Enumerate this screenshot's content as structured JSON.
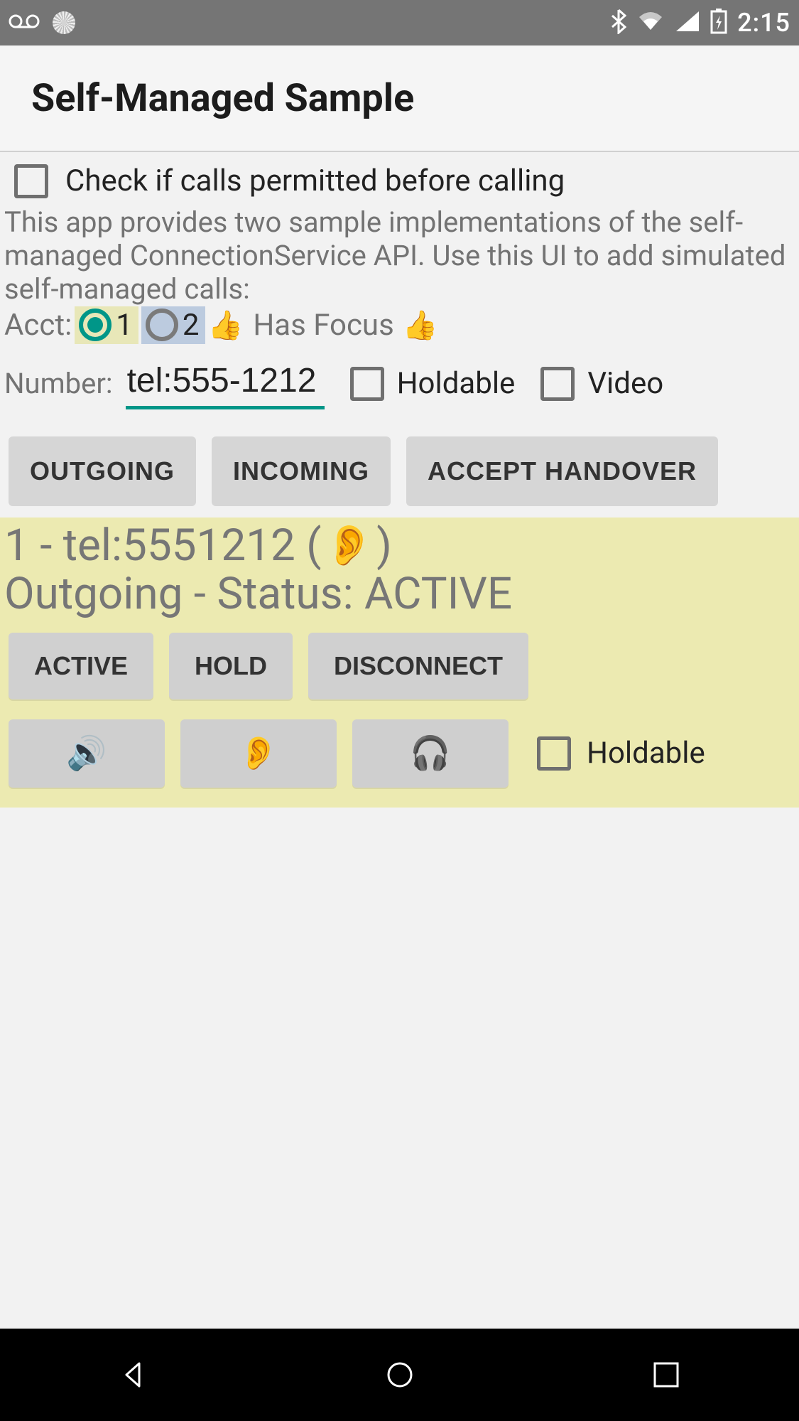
{
  "statusbar": {
    "time": "2:15"
  },
  "actionbar": {
    "title": "Self-Managed Sample"
  },
  "check_permitted": {
    "label": "Check if calls permitted before calling",
    "checked": false
  },
  "description": "This app provides two sample implementations of the self-managed ConnectionService API.  Use this UI to add simulated self-managed calls:",
  "acct": {
    "label": "Acct:",
    "option1": "1",
    "option2": "2",
    "selected": 1,
    "focus_label": "Has Focus",
    "thumb": "👍"
  },
  "number": {
    "label": "Number:",
    "value": "tel:555-1212"
  },
  "holdable_top": {
    "label": "Holdable",
    "checked": false
  },
  "video": {
    "label": "Video",
    "checked": false
  },
  "buttons": {
    "outgoing": "OUTGOING",
    "incoming": "INCOMING",
    "accept_handover": "ACCEPT HANDOVER"
  },
  "call": {
    "line1_prefix": "1 - tel:5551212 ( ",
    "ear": "👂",
    "line1_suffix": " )",
    "line2": "Outgoing - Status: ACTIVE",
    "btn_active": "ACTIVE",
    "btn_hold": "HOLD",
    "btn_disconnect": "DISCONNECT",
    "audio_speaker": "🔊",
    "audio_ear": "👂",
    "audio_headset": "🎧",
    "holdable_label": "Holdable",
    "holdable_checked": false
  }
}
